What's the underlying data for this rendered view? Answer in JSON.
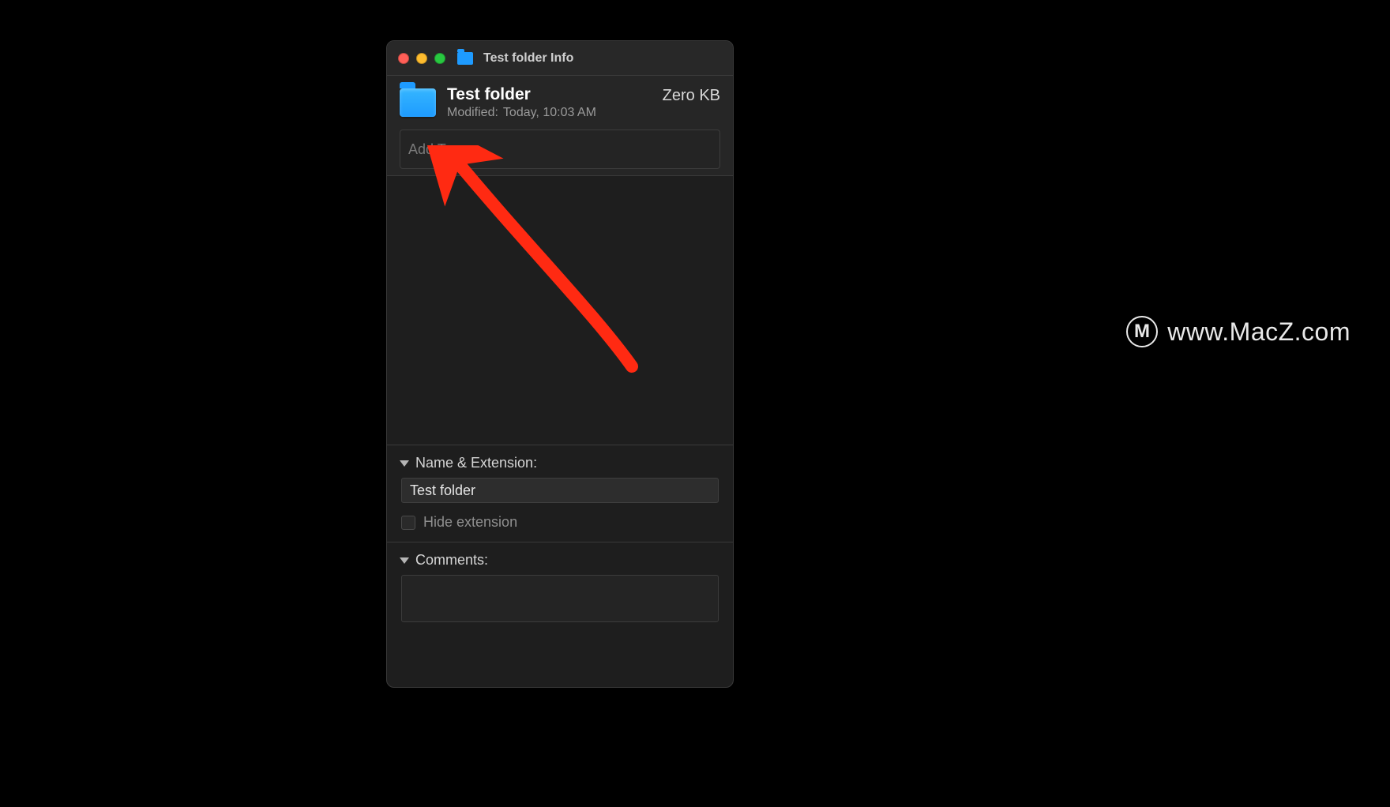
{
  "window": {
    "title": "Test folder Info"
  },
  "header": {
    "folder_name": "Test folder",
    "modified_label": "Modified:",
    "modified_value": "Today, 10:03 AM",
    "size": "Zero KB",
    "tags_placeholder": "Add Tags..."
  },
  "sections": {
    "name_ext": {
      "title": "Name & Extension:",
      "value": "Test folder",
      "hide_ext_label": "Hide extension",
      "hide_ext_checked": false
    },
    "comments": {
      "title": "Comments:",
      "value": ""
    }
  },
  "watermark": {
    "icon_letter": "M",
    "text": "www.MacZ.com"
  }
}
